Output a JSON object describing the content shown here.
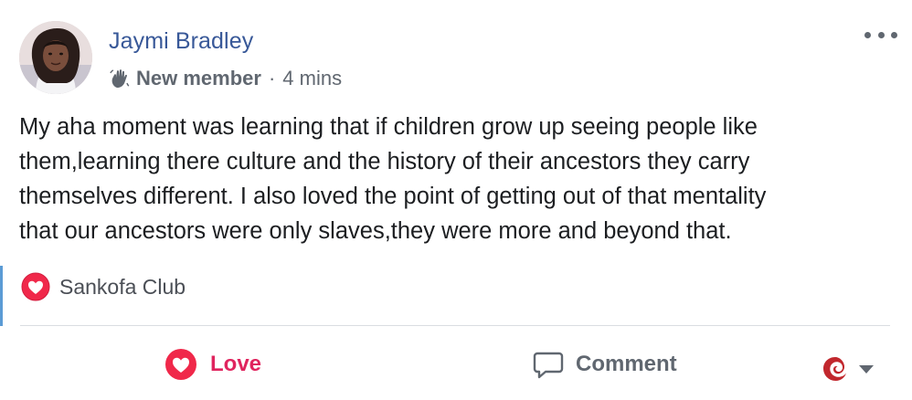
{
  "post": {
    "author": "Jaymi Bradley",
    "badge": "New member",
    "separator": "·",
    "time": "4 mins",
    "text_lines": [
      "My aha moment was learning that if children grow up seeing people like",
      "them,learning there culture and the history of their ancestors they carry",
      "themselves different. I also loved the point of getting out of that mentality",
      "that our ancestors were only slaves,they were more and beyond that."
    ],
    "group_tag": "Sankofa Club"
  },
  "actions": {
    "love_label": "Love",
    "comment_label": "Comment"
  },
  "icons": {
    "menu": "more-options-icon",
    "badge": "wave-hand-icon",
    "love": "love-heart-icon",
    "comment": "comment-bubble-icon",
    "reaction": "reaction-selector-icon"
  },
  "colors": {
    "author": "#385898",
    "love": "#e0245e",
    "muted": "#606770",
    "accent": "#5b9bd5"
  }
}
